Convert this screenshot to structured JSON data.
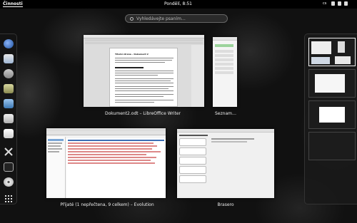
{
  "topbar": {
    "activities": "Činnosti",
    "clock": "Pondělí,  8:51",
    "keyboard": "cs"
  },
  "search": {
    "placeholder": "Vyhledávejte psaním…"
  },
  "dash": {
    "apps": [
      "web-browser-icon",
      "email-icon",
      "chat-icon",
      "music-icon",
      "system-monitor-icon",
      "files-icon",
      "text-editor-icon",
      "tools-icon",
      "terminal-icon",
      "disc-burner-icon",
      "show-applications-icon"
    ]
  },
  "windows": [
    {
      "caption": "Dokument2.odt – LibreOffice Writer",
      "doc_title": "Titulní strana – Dokument 2"
    },
    {
      "caption": "Seznam…"
    },
    {
      "caption": "Přijaté (1 nepřečtena, 9 celkem) – Evolution"
    },
    {
      "caption": "Brasero"
    }
  ],
  "workspaces": {
    "count": 4,
    "active_index": 0
  },
  "colors": {
    "topbar": "#000000",
    "background": "#111111",
    "accent": "#3c6eb4"
  }
}
